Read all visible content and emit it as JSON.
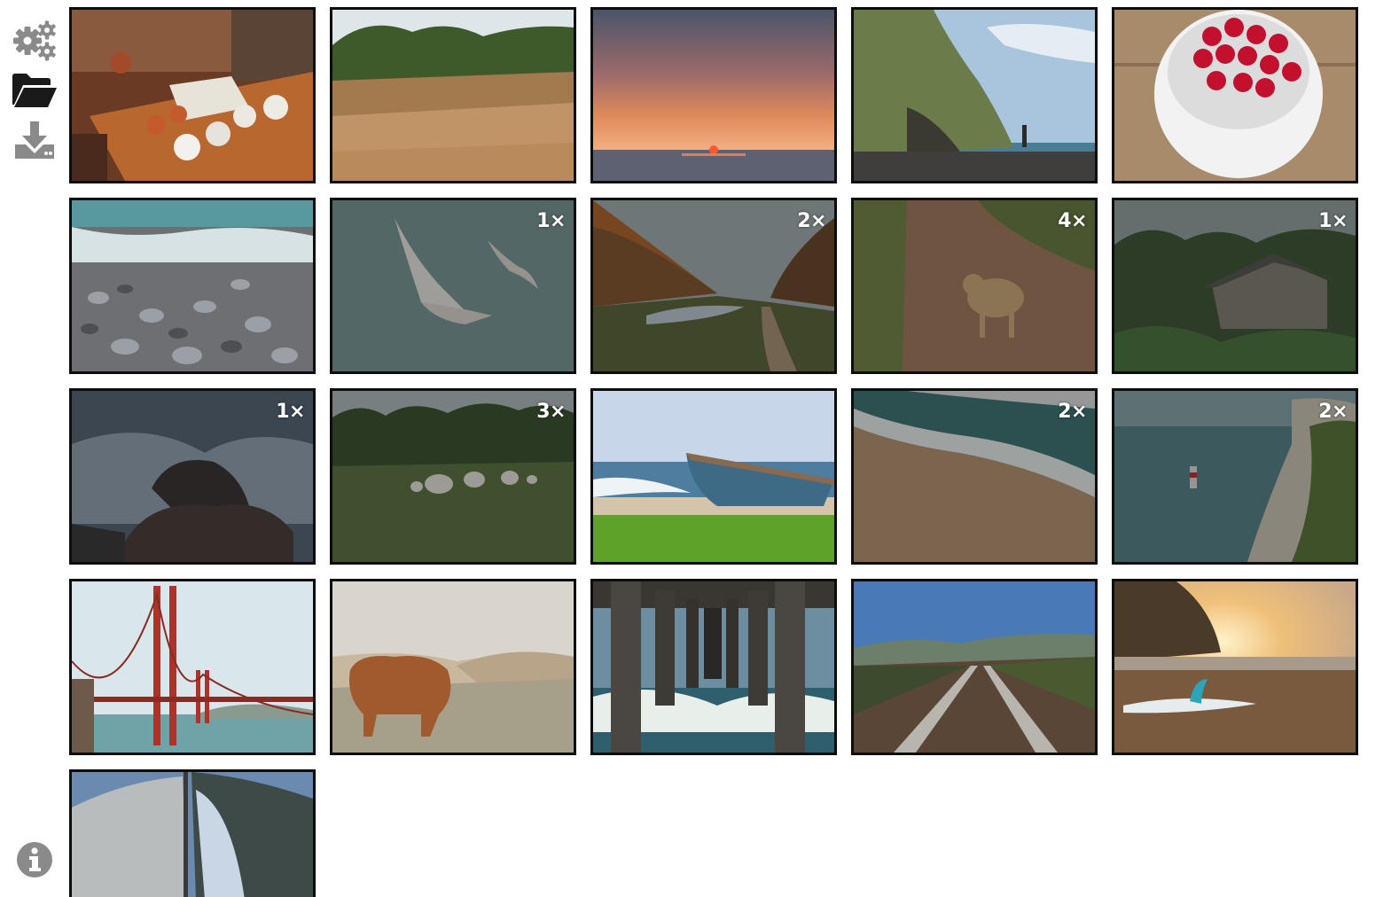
{
  "sidebar": {
    "icons": [
      {
        "name": "settings-gears-icon",
        "label": "Settings"
      },
      {
        "name": "folder-open-icon",
        "label": "Open"
      },
      {
        "name": "download-icon",
        "label": "Download"
      },
      {
        "name": "info-icon",
        "label": "Info"
      }
    ]
  },
  "colors": {
    "icon_gray": "#8a8a8a",
    "icon_dark": "#1a1a1a",
    "tile_border": "#0d0d0d",
    "badge_text": "#ffffff"
  },
  "photos": [
    {
      "subject": "tea cups on wooden table",
      "badge": "",
      "dimmed": false
    },
    {
      "subject": "dry grass field",
      "badge": "",
      "dimmed": false
    },
    {
      "subject": "sunset over sea",
      "badge": "",
      "dimmed": false
    },
    {
      "subject": "sea cliff and beach",
      "badge": "",
      "dimmed": false
    },
    {
      "subject": "raspberries in white cup",
      "badge": "",
      "dimmed": false
    },
    {
      "subject": "pebble beach with waves",
      "badge": "",
      "dimmed": false
    },
    {
      "subject": "seagulls in flight",
      "badge": "1×",
      "dimmed": true
    },
    {
      "subject": "autumn valley road",
      "badge": "2×",
      "dimmed": true
    },
    {
      "subject": "leopard on dirt road",
      "badge": "4×",
      "dimmed": true
    },
    {
      "subject": "hut in jungle",
      "badge": "1×",
      "dimmed": true
    },
    {
      "subject": "waves crashing on rocks",
      "badge": "1×",
      "dimmed": true
    },
    {
      "subject": "sheep in meadow",
      "badge": "3×",
      "dimmed": true
    },
    {
      "subject": "boat on beach",
      "badge": "",
      "dimmed": false
    },
    {
      "subject": "aerial wave on beach",
      "badge": "2×",
      "dimmed": true
    },
    {
      "subject": "lighthouse below cliff",
      "badge": "2×",
      "dimmed": true
    },
    {
      "subject": "golden gate bridge",
      "badge": "",
      "dimmed": false
    },
    {
      "subject": "highland cow",
      "badge": "",
      "dimmed": false
    },
    {
      "subject": "under the pier",
      "badge": "",
      "dimmed": false
    },
    {
      "subject": "railway tracks",
      "badge": "",
      "dimmed": false
    },
    {
      "subject": "surfboard on beach at sunset",
      "badge": "",
      "dimmed": false
    },
    {
      "subject": "sailboat sail",
      "badge": "",
      "dimmed": false
    }
  ]
}
